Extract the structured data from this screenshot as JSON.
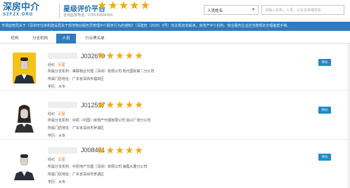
{
  "header": {
    "logo_main": "深房中介",
    "logo_sub": "SZFZX.ORG",
    "site_title": "星级评价平台",
    "site_sub": "咨询监督电话：0755-83584304",
    "stars": 5,
    "search_select": "人员姓名",
    "search_placeholder": "请输入机构，人员，以及名称或姓名"
  },
  "ticker": "市场监管局关于《深圳市住房和建设局关于规范物业服务员管理中介服务行为的通知》（深建管〔2020〕5号）有关规定的解读，房地产中介机构、物业服务企业应当按规定办理备案手续。",
  "tabs": [
    "机构",
    "分支机构",
    "人员",
    "行业黑名单"
  ],
  "active_tab": 2,
  "rate_label": "评价",
  "labels": {
    "role": "经纪",
    "branch": "所属分支机构：",
    "address": "所属门店地址：",
    "education": "学历："
  },
  "agents": [
    {
      "id": "J032679",
      "stars": 5,
      "grade": "五星",
      "branch": "美联物业代理（深圳）有限公司 现代国际第二分公司",
      "address": "广东省深圳市福田区",
      "education": "大专"
    },
    {
      "id": "J012517",
      "stars": 5,
      "grade": "五星",
      "branch": "中原（中国）房地产代理有限公司 信兴广场分公司",
      "address": "广东省深圳市罗湖区",
      "education": "大专"
    },
    {
      "id": "J008481",
      "stars": 5,
      "grade": "五星",
      "branch": "中原地产代理（深圳）有限公司 海霞大厦分公司",
      "address": "广东省深圳市罗湖区",
      "education": "大专"
    }
  ],
  "colors": {
    "brand": "#1f6fb2",
    "bar": "#2f7bbd",
    "star": "#f0a81c",
    "grade": "#ed7a1c"
  }
}
